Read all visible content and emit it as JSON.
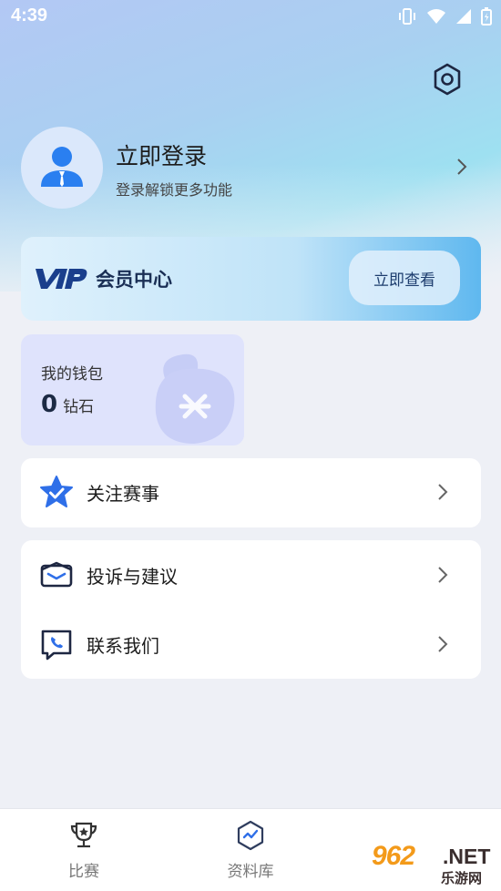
{
  "status_bar": {
    "time": "4:39",
    "icons": [
      "vibrate-icon",
      "wifi-icon",
      "signal-icon",
      "battery-icon"
    ]
  },
  "header": {
    "settings_icon": "gear-icon"
  },
  "profile": {
    "title": "立即登录",
    "subtitle": "登录解锁更多功能",
    "avatar_icon": "user-avatar-icon"
  },
  "vip": {
    "logo": "VIP",
    "title": "会员中心",
    "button_label": "立即查看"
  },
  "wallet": {
    "title": "我的钱包",
    "amount": "0",
    "unit": "钻石"
  },
  "menu_group_1": [
    {
      "label": "关注赛事",
      "icon": "star-check-icon"
    }
  ],
  "menu_group_2": [
    {
      "label": "投诉与建议",
      "icon": "envelope-icon"
    },
    {
      "label": "联系我们",
      "icon": "phone-chat-icon"
    }
  ],
  "tabbar": {
    "tabs": [
      {
        "label": "比赛",
        "icon": "trophy-icon"
      },
      {
        "label": "资料库",
        "icon": "stats-shield-icon"
      }
    ]
  },
  "watermark": {
    "number": "962",
    "net": ".NET",
    "site": "乐游网"
  },
  "colors": {
    "accent_blue": "#2f6fe8",
    "vip_gradient_end": "#5fb8ef",
    "watermark_orange": "#f39a1a"
  }
}
